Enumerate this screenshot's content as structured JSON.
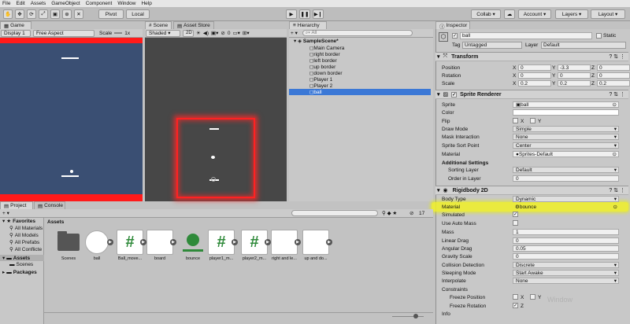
{
  "menubar": [
    "File",
    "Edit",
    "Assets",
    "GameObject",
    "Component",
    "Window",
    "Help"
  ],
  "toolbar": {
    "pivot": "Pivot",
    "local": "Local",
    "collab": "Collab ▾",
    "account": "Account",
    "layers": "Layers",
    "layout": "Layout"
  },
  "game": {
    "tab": "Game",
    "display": "Display 1",
    "aspect": "Free Aspect",
    "scale_label": "Scale",
    "scale_value": "1x"
  },
  "scene": {
    "tab": "Scene",
    "asset_store_tab": "Asset Store",
    "shading": "Shaded",
    "mode2d": "2D",
    "count": "0"
  },
  "hierarchy": {
    "tab": "Hierarchy",
    "create": "+ ▾",
    "search_placeholder": "All",
    "scene": "SampleScene*",
    "items": [
      "Main Camera",
      "right border",
      "left border",
      "up border",
      "down border",
      "Player 1",
      "Player 2",
      "ball"
    ],
    "selected": "ball"
  },
  "inspector": {
    "tab": "Inspector",
    "name": "ball",
    "static": "Static",
    "tag_label": "Tag",
    "tag_value": "Untagged",
    "layer_label": "Layer",
    "layer_value": "Default",
    "transform": {
      "title": "Transform",
      "position_label": "Position",
      "rotation_label": "Rotation",
      "scale_label": "Scale",
      "position": {
        "x": "0",
        "y": "-3.3",
        "z": "0"
      },
      "rotation": {
        "x": "0",
        "y": "0",
        "z": "0"
      },
      "scale": {
        "x": "0.2",
        "y": "0.2",
        "z": "0.2"
      }
    },
    "sprite_renderer": {
      "title": "Sprite Renderer",
      "sprite_label": "Sprite",
      "sprite_value": "ball",
      "color_label": "Color",
      "flip_label": "Flip",
      "flip_x": "X",
      "flip_y": "Y",
      "draw_mode_label": "Draw Mode",
      "draw_mode_value": "Simple",
      "mask_label": "Mask Interaction",
      "mask_value": "None",
      "sort_point_label": "Sprite Sort Point",
      "sort_point_value": "Center",
      "material_label": "Material",
      "material_value": "Sprites-Default",
      "additional": "Additional Settings",
      "sorting_layer_label": "Sorting Layer",
      "sorting_layer_value": "Default",
      "order_label": "Order in Layer",
      "order_value": "0"
    },
    "rigidbody": {
      "title": "Rigidbody 2D",
      "body_type_label": "Body Type",
      "body_type_value": "Dynamic",
      "material_label": "Material",
      "material_value": "bounce",
      "simulated_label": "Simulated",
      "auto_mass_label": "Use Auto Mass",
      "mass_label": "Mass",
      "mass_value": "1",
      "linear_drag_label": "Linear Drag",
      "linear_drag_value": "0",
      "angular_drag_label": "Angular Drag",
      "angular_drag_value": "0.05",
      "gravity_label": "Gravity Scale",
      "gravity_value": "0",
      "collision_label": "Collision Detection",
      "collision_value": "Discrete",
      "sleeping_label": "Sleeping Mode",
      "sleeping_value": "Start Awake",
      "interpolate_label": "Interpolate",
      "interpolate_value": "None",
      "constraints": "Constraints",
      "freeze_pos_label": "Freeze Position",
      "freeze_rot_label": "Freeze Rotation",
      "axis_x": "X",
      "axis_y": "Y",
      "axis_z": "Z",
      "info": "Info"
    },
    "watermark": "Window"
  },
  "project": {
    "tab": "Project",
    "console_tab": "Console",
    "create": "+ ▾",
    "count": "17",
    "favorites": "Favorites",
    "fav_items": [
      "All Materials",
      "All Models",
      "All Prefabs",
      "All Conflicte"
    ],
    "assets_root": "Assets",
    "assets_children": [
      "Scenes"
    ],
    "packages": "Packages",
    "breadcrumb": "Assets",
    "assets": [
      {
        "label": "Scenes",
        "kind": "folder"
      },
      {
        "label": "ball",
        "kind": "sprite-circle"
      },
      {
        "label": "Ball_move...",
        "kind": "script"
      },
      {
        "label": "board",
        "kind": "sprite-white"
      },
      {
        "label": "bounce",
        "kind": "physics-material"
      },
      {
        "label": "player1_m...",
        "kind": "script"
      },
      {
        "label": "player2_m...",
        "kind": "script"
      },
      {
        "label": "right and le...",
        "kind": "sprite-white"
      },
      {
        "label": "up and do...",
        "kind": "sprite-white"
      }
    ]
  },
  "colors": {
    "game_bg": "#3a4f73",
    "border_red": "#ff1a1a",
    "scene_bg": "#474747",
    "highlight": "#e8f000",
    "selection": "#3b78d6",
    "script_green": "#2f8a3a"
  }
}
